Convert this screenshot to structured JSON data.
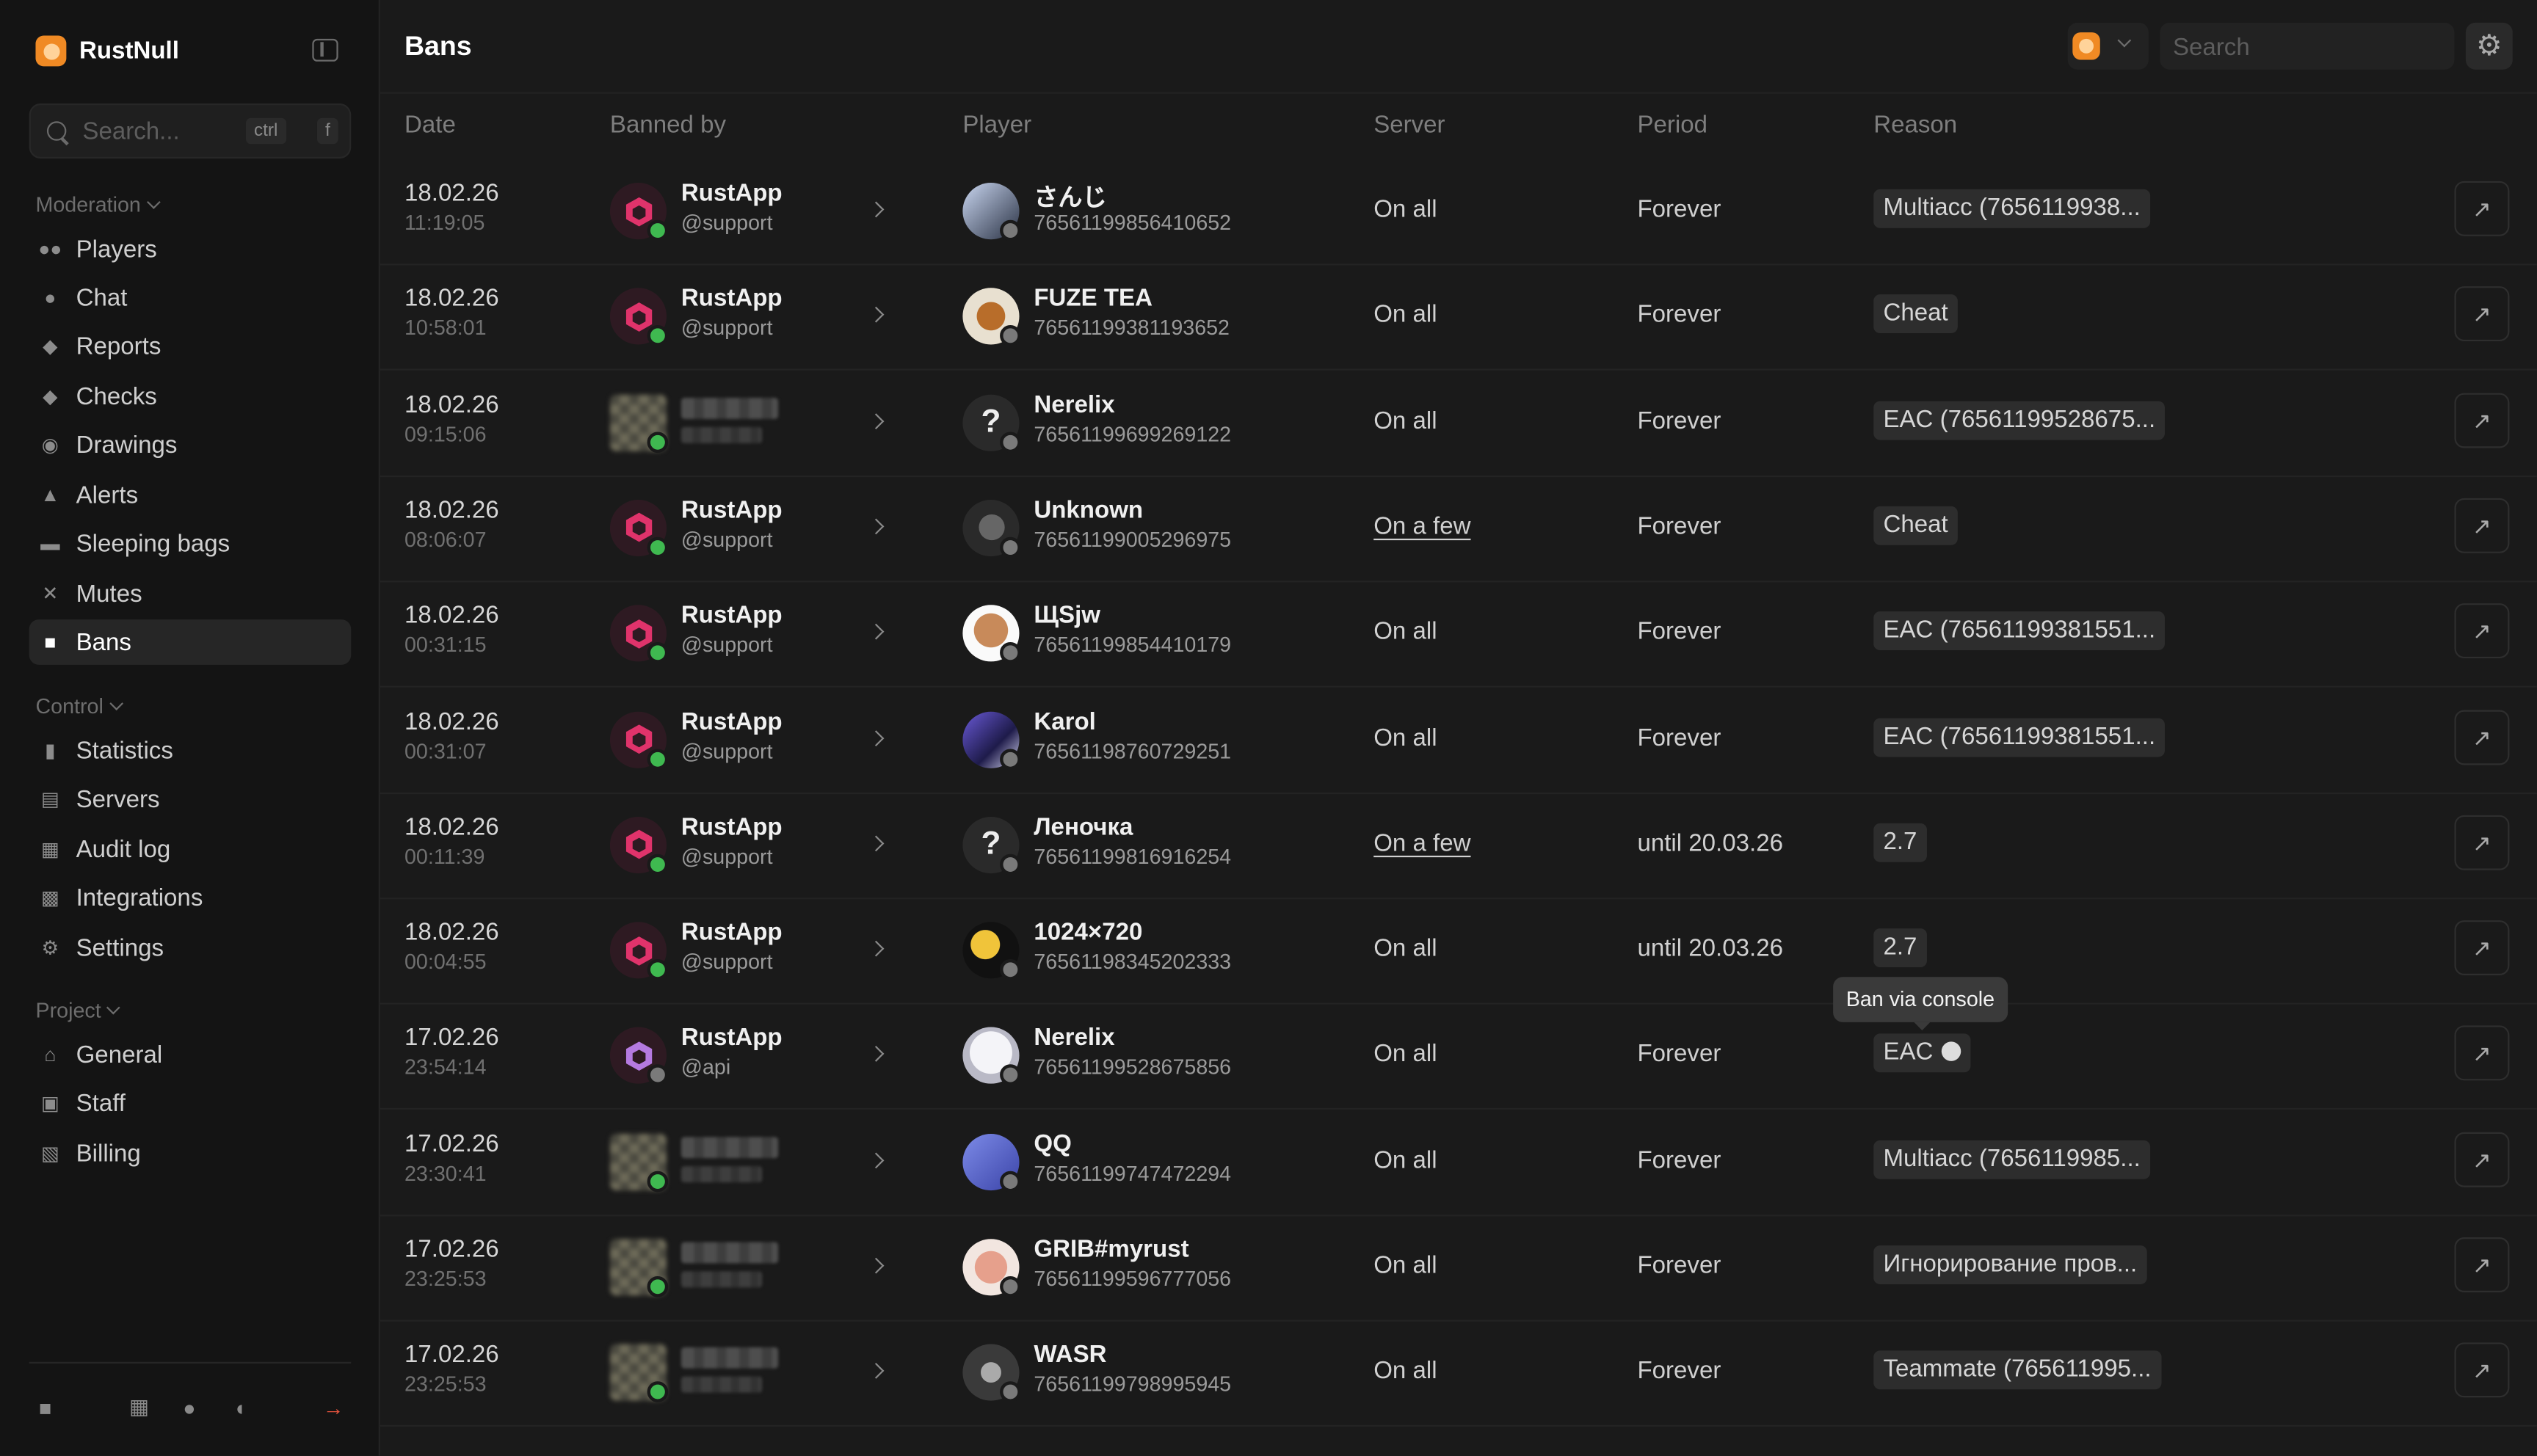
{
  "app": {
    "name": "RustNull"
  },
  "sidebar": {
    "search_placeholder": "Search...",
    "kbd_ctrl": "ctrl",
    "kbd_plus": "+",
    "kbd_f": "f",
    "groups": [
      {
        "label": "Moderation",
        "items": [
          "Players",
          "Chat",
          "Reports",
          "Checks",
          "Drawings",
          "Alerts",
          "Sleeping bags",
          "Mutes",
          "Bans"
        ]
      },
      {
        "label": "Control",
        "items": [
          "Statistics",
          "Servers",
          "Audit log",
          "Integrations",
          "Settings"
        ]
      },
      {
        "label": "Project",
        "items": [
          "General",
          "Staff",
          "Billing"
        ]
      }
    ],
    "active_item": "Bans"
  },
  "header": {
    "title": "Bans",
    "search_placeholder": "Search"
  },
  "table": {
    "columns": [
      "Date",
      "Banned by",
      "Player",
      "Server",
      "Period",
      "Reason"
    ],
    "rows": [
      {
        "date": "18.02.26",
        "time": "11:19:05",
        "staff": "RustApp",
        "handle": "@support",
        "player": "さんじ",
        "steam_id": "76561199856410652",
        "server": "On all",
        "period": "Forever",
        "reason": "Multiacc (7656119938..."
      },
      {
        "date": "18.02.26",
        "time": "10:58:01",
        "staff": "RustApp",
        "handle": "@support",
        "player": "FUZE TEA",
        "steam_id": "76561199381193652",
        "server": "On all",
        "period": "Forever",
        "reason": "Cheat"
      },
      {
        "date": "18.02.26",
        "time": "09:15:06",
        "staff": "",
        "handle": "",
        "player": "Nerelix",
        "steam_id": "76561199699269122",
        "server": "On all",
        "period": "Forever",
        "reason": "EAC (76561199528675..."
      },
      {
        "date": "18.02.26",
        "time": "08:06:07",
        "staff": "RustApp",
        "handle": "@support",
        "player": "Unknown",
        "steam_id": "76561199005296975",
        "server": "On a few",
        "period": "Forever",
        "reason": "Cheat"
      },
      {
        "date": "18.02.26",
        "time": "00:31:15",
        "staff": "RustApp",
        "handle": "@support",
        "player": "ЩSjw",
        "steam_id": "76561199854410179",
        "server": "On all",
        "period": "Forever",
        "reason": "EAC (76561199381551..."
      },
      {
        "date": "18.02.26",
        "time": "00:31:07",
        "staff": "RustApp",
        "handle": "@support",
        "player": "Karol",
        "steam_id": "76561198760729251",
        "server": "On all",
        "period": "Forever",
        "reason": "EAC (76561199381551..."
      },
      {
        "date": "18.02.26",
        "time": "00:11:39",
        "staff": "RustApp",
        "handle": "@support",
        "player": "Леночка",
        "steam_id": "76561199816916254",
        "server": "On a few",
        "period": "until 20.03.26",
        "reason": "2.7"
      },
      {
        "date": "18.02.26",
        "time": "00:04:55",
        "staff": "RustApp",
        "handle": "@support",
        "player": "1024×720",
        "steam_id": "76561198345202333",
        "server": "On all",
        "period": "until 20.03.26",
        "reason": "2.7"
      },
      {
        "date": "17.02.26",
        "time": "23:54:14",
        "staff": "RustApp",
        "handle": "@api",
        "player": "Nerelix",
        "steam_id": "76561199528675856",
        "server": "On all",
        "period": "Forever",
        "reason": "EAC"
      },
      {
        "date": "17.02.26",
        "time": "23:30:41",
        "staff": "",
        "handle": "",
        "player": "QQ",
        "steam_id": "76561199747472294",
        "server": "On all",
        "period": "Forever",
        "reason": "Multiacc (7656119985..."
      },
      {
        "date": "17.02.26",
        "time": "23:25:53",
        "staff": "",
        "handle": "",
        "player": "GRIB#myrust",
        "steam_id": "76561199596777056",
        "server": "On all",
        "period": "Forever",
        "reason": "Игнорирование пров..."
      },
      {
        "date": "17.02.26",
        "time": "23:25:53",
        "staff": "",
        "handle": "",
        "player": "WASR",
        "steam_id": "76561199798995945",
        "server": "On all",
        "period": "Forever",
        "reason": "Teammate (765611995..."
      }
    ]
  },
  "tooltip": {
    "text": "Ban via console"
  },
  "colors": {
    "accent": "#f08a24",
    "online": "#3fb950",
    "offline": "#7a7a7a",
    "logout": "#e5533d",
    "rustapp": "#e0336b"
  }
}
